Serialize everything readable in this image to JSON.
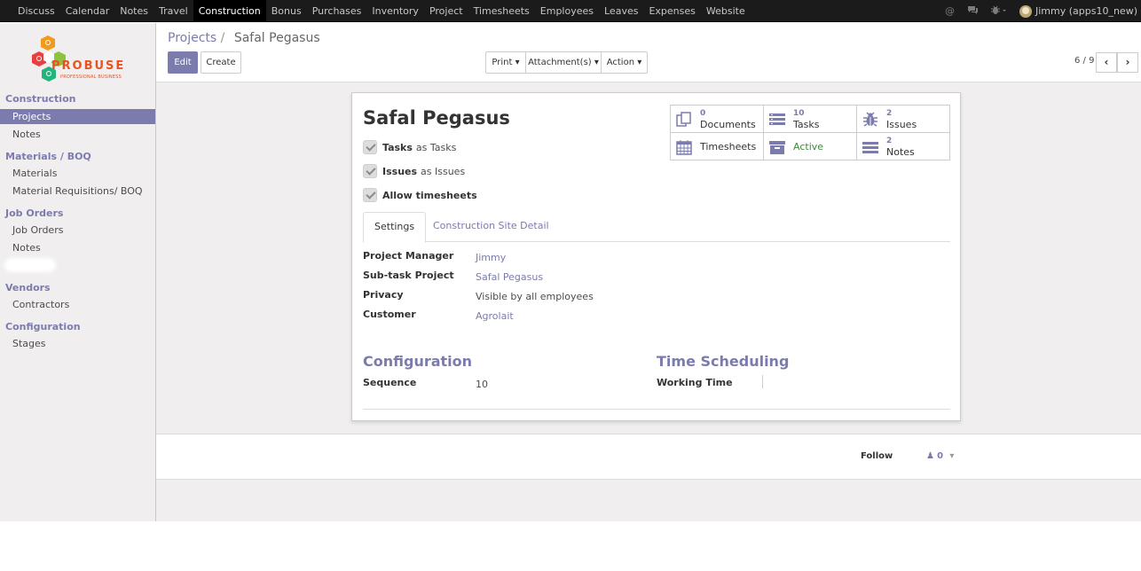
{
  "topbar": {
    "menu": [
      "Discuss",
      "Calendar",
      "Notes",
      "Travel",
      "Construction",
      "Bonus",
      "Purchases",
      "Inventory",
      "Project",
      "Timesheets",
      "Employees",
      "Leaves",
      "Expenses",
      "Website"
    ],
    "active": "Construction",
    "user": "Jimmy (apps10_new)"
  },
  "logo": {
    "text": "PROBUSE",
    "subtitle": "PROFESSIONAL BUSINESS"
  },
  "sidebar": {
    "sections": [
      {
        "title": "Construction",
        "items": [
          "Projects",
          "Notes"
        ]
      },
      {
        "title": "Materials / BOQ",
        "items": [
          "Materials",
          "Material Requisitions/ BOQ"
        ]
      },
      {
        "title": "Job Orders",
        "items": [
          "Job Orders",
          "Notes"
        ]
      },
      {
        "title": "Vendors",
        "items": [
          "Contractors"
        ]
      },
      {
        "title": "Configuration",
        "items": [
          "Stages"
        ]
      }
    ],
    "active_item": "Projects"
  },
  "breadcrumb": {
    "parent": "Projects",
    "separator": "/",
    "current": "Safal Pegasus"
  },
  "toolbar": {
    "edit": "Edit",
    "create": "Create",
    "print": "Print",
    "attachments": "Attachment(s)",
    "action": "Action"
  },
  "pager": {
    "value": "6 / 9"
  },
  "form": {
    "name": "Safal Pegasus",
    "checkboxes": [
      {
        "bold": "Tasks",
        "rest": "as Tasks",
        "checked": true
      },
      {
        "bold": "Issues",
        "rest": "as Issues",
        "checked": true
      },
      {
        "bold": "Allow timesheets",
        "rest": "",
        "checked": true
      }
    ],
    "smart_buttons": {
      "documents": {
        "count": "0",
        "label": "Documents"
      },
      "tasks": {
        "count": "10",
        "label": "Tasks"
      },
      "issues": {
        "count": "2",
        "label": "Issues"
      },
      "timesheets": {
        "label": "Timesheets"
      },
      "active": {
        "label": "Active"
      },
      "notes": {
        "count": "2",
        "label": "Notes"
      }
    },
    "tabs": [
      "Settings",
      "Construction Site Detail"
    ],
    "active_tab": "Settings",
    "fields": [
      {
        "label": "Project Manager",
        "value": "Jimmy"
      },
      {
        "label": "Sub-task Project",
        "value": "Safal Pegasus"
      },
      {
        "label": "Privacy",
        "value": "Visible by all employees"
      },
      {
        "label": "Customer",
        "value": "Agrolait"
      }
    ],
    "configuration": {
      "title": "Configuration",
      "sequence_label": "Sequence",
      "sequence_value": "10"
    },
    "time_scheduling": {
      "title": "Time Scheduling",
      "working_time_label": "Working Time"
    }
  },
  "chatter": {
    "follow": "Follow",
    "followers": "0"
  },
  "colors": {
    "accent": "#7c7bad",
    "topbar": "#1b1b1b",
    "active_status": "#3e8a3e"
  }
}
